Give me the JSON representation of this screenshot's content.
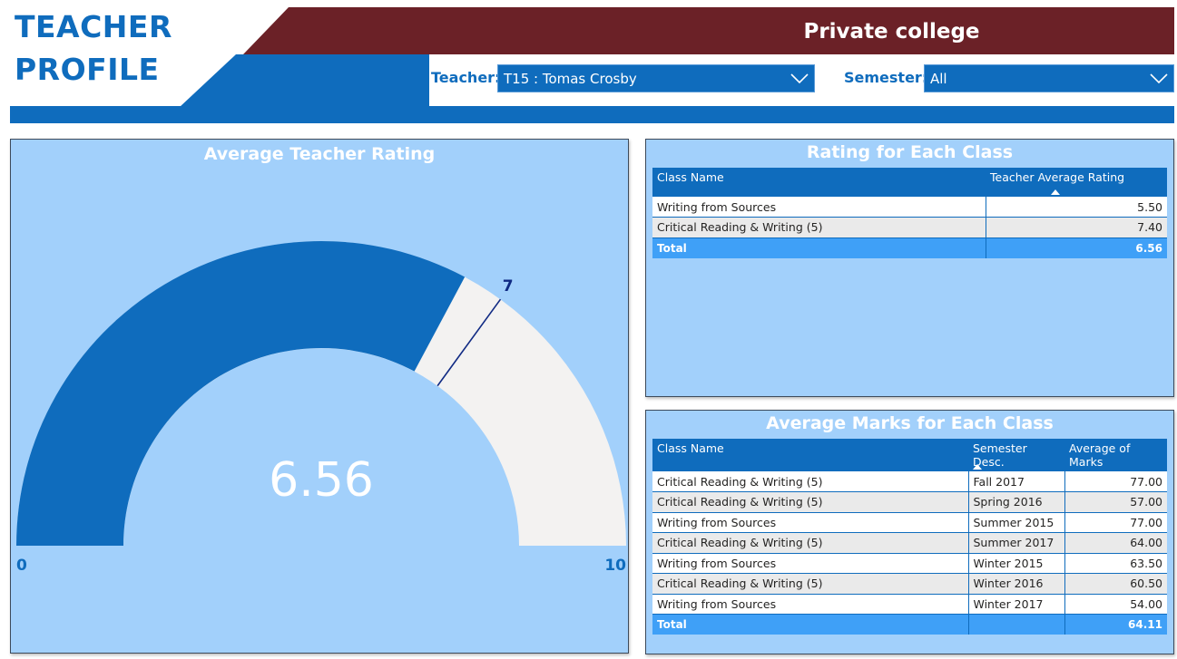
{
  "header": {
    "title_line1": "TEACHER",
    "title_line2": "PROFILE",
    "banner_title": "Private college",
    "colors": {
      "primary_blue": "#0f6cbd",
      "maroon": "#6b2127",
      "panel_bg": "#a2d0fb",
      "total_row": "#3fa0f7"
    }
  },
  "filters": {
    "teacher_label": "Teacher:",
    "teacher_value": "T15 : Tomas Crosby",
    "semester_label": "Semester:",
    "semester_value": "All",
    "dropdown_icon": "chevron-down-icon"
  },
  "gauge": {
    "title": "Average Teacher Rating",
    "value": 6.56,
    "value_label": "6.56",
    "min": 0,
    "max": 10,
    "min_label": "0",
    "max_label": "10",
    "target": 7,
    "target_label": "7"
  },
  "rating_table": {
    "title": "Rating for Each Class",
    "columns": [
      "Class Name",
      "Teacher Average Rating"
    ],
    "rows": [
      [
        "Writing from Sources",
        "5.50"
      ],
      [
        "Critical Reading & Writing (5)",
        "7.40"
      ]
    ],
    "total": [
      "Total",
      "6.56"
    ]
  },
  "marks_table": {
    "title": "Average Marks for Each Class",
    "columns": [
      "Class Name",
      "Semester Desc.",
      "Average of Marks"
    ],
    "rows": [
      [
        "Critical Reading & Writing (5)",
        "Fall 2017",
        "77.00"
      ],
      [
        "Critical Reading & Writing (5)",
        "Spring 2016",
        "57.00"
      ],
      [
        "Writing from Sources",
        "Summer 2015",
        "77.00"
      ],
      [
        "Critical Reading & Writing (5)",
        "Summer 2017",
        "64.00"
      ],
      [
        "Writing from Sources",
        "Winter 2015",
        "63.50"
      ],
      [
        "Critical Reading & Writing (5)",
        "Winter 2016",
        "60.50"
      ],
      [
        "Writing from Sources",
        "Winter 2017",
        "54.00"
      ]
    ],
    "total": [
      "Total",
      "",
      "64.11"
    ]
  }
}
